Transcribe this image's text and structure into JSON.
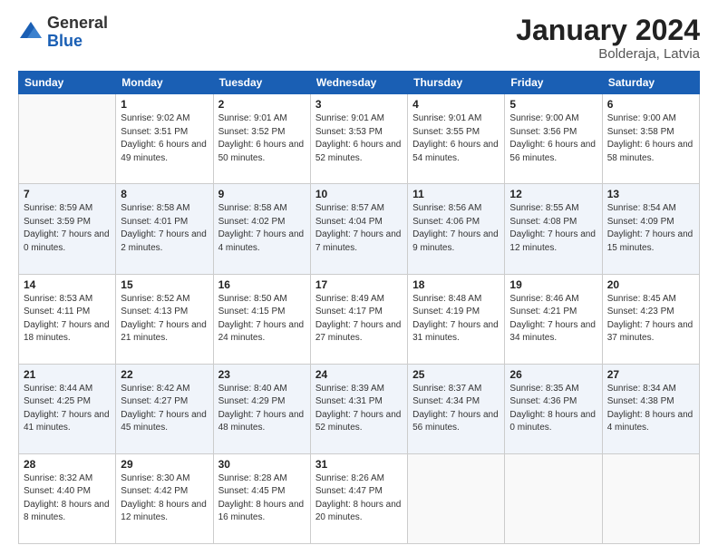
{
  "header": {
    "logo_general": "General",
    "logo_blue": "Blue",
    "month_title": "January 2024",
    "location": "Bolderaja, Latvia"
  },
  "days_of_week": [
    "Sunday",
    "Monday",
    "Tuesday",
    "Wednesday",
    "Thursday",
    "Friday",
    "Saturday"
  ],
  "weeks": [
    [
      {
        "day": "",
        "empty": true
      },
      {
        "day": "1",
        "sunrise": "Sunrise: 9:02 AM",
        "sunset": "Sunset: 3:51 PM",
        "daylight": "Daylight: 6 hours and 49 minutes."
      },
      {
        "day": "2",
        "sunrise": "Sunrise: 9:01 AM",
        "sunset": "Sunset: 3:52 PM",
        "daylight": "Daylight: 6 hours and 50 minutes."
      },
      {
        "day": "3",
        "sunrise": "Sunrise: 9:01 AM",
        "sunset": "Sunset: 3:53 PM",
        "daylight": "Daylight: 6 hours and 52 minutes."
      },
      {
        "day": "4",
        "sunrise": "Sunrise: 9:01 AM",
        "sunset": "Sunset: 3:55 PM",
        "daylight": "Daylight: 6 hours and 54 minutes."
      },
      {
        "day": "5",
        "sunrise": "Sunrise: 9:00 AM",
        "sunset": "Sunset: 3:56 PM",
        "daylight": "Daylight: 6 hours and 56 minutes."
      },
      {
        "day": "6",
        "sunrise": "Sunrise: 9:00 AM",
        "sunset": "Sunset: 3:58 PM",
        "daylight": "Daylight: 6 hours and 58 minutes."
      }
    ],
    [
      {
        "day": "7",
        "sunrise": "Sunrise: 8:59 AM",
        "sunset": "Sunset: 3:59 PM",
        "daylight": "Daylight: 7 hours and 0 minutes."
      },
      {
        "day": "8",
        "sunrise": "Sunrise: 8:58 AM",
        "sunset": "Sunset: 4:01 PM",
        "daylight": "Daylight: 7 hours and 2 minutes."
      },
      {
        "day": "9",
        "sunrise": "Sunrise: 8:58 AM",
        "sunset": "Sunset: 4:02 PM",
        "daylight": "Daylight: 7 hours and 4 minutes."
      },
      {
        "day": "10",
        "sunrise": "Sunrise: 8:57 AM",
        "sunset": "Sunset: 4:04 PM",
        "daylight": "Daylight: 7 hours and 7 minutes."
      },
      {
        "day": "11",
        "sunrise": "Sunrise: 8:56 AM",
        "sunset": "Sunset: 4:06 PM",
        "daylight": "Daylight: 7 hours and 9 minutes."
      },
      {
        "day": "12",
        "sunrise": "Sunrise: 8:55 AM",
        "sunset": "Sunset: 4:08 PM",
        "daylight": "Daylight: 7 hours and 12 minutes."
      },
      {
        "day": "13",
        "sunrise": "Sunrise: 8:54 AM",
        "sunset": "Sunset: 4:09 PM",
        "daylight": "Daylight: 7 hours and 15 minutes."
      }
    ],
    [
      {
        "day": "14",
        "sunrise": "Sunrise: 8:53 AM",
        "sunset": "Sunset: 4:11 PM",
        "daylight": "Daylight: 7 hours and 18 minutes."
      },
      {
        "day": "15",
        "sunrise": "Sunrise: 8:52 AM",
        "sunset": "Sunset: 4:13 PM",
        "daylight": "Daylight: 7 hours and 21 minutes."
      },
      {
        "day": "16",
        "sunrise": "Sunrise: 8:50 AM",
        "sunset": "Sunset: 4:15 PM",
        "daylight": "Daylight: 7 hours and 24 minutes."
      },
      {
        "day": "17",
        "sunrise": "Sunrise: 8:49 AM",
        "sunset": "Sunset: 4:17 PM",
        "daylight": "Daylight: 7 hours and 27 minutes."
      },
      {
        "day": "18",
        "sunrise": "Sunrise: 8:48 AM",
        "sunset": "Sunset: 4:19 PM",
        "daylight": "Daylight: 7 hours and 31 minutes."
      },
      {
        "day": "19",
        "sunrise": "Sunrise: 8:46 AM",
        "sunset": "Sunset: 4:21 PM",
        "daylight": "Daylight: 7 hours and 34 minutes."
      },
      {
        "day": "20",
        "sunrise": "Sunrise: 8:45 AM",
        "sunset": "Sunset: 4:23 PM",
        "daylight": "Daylight: 7 hours and 37 minutes."
      }
    ],
    [
      {
        "day": "21",
        "sunrise": "Sunrise: 8:44 AM",
        "sunset": "Sunset: 4:25 PM",
        "daylight": "Daylight: 7 hours and 41 minutes."
      },
      {
        "day": "22",
        "sunrise": "Sunrise: 8:42 AM",
        "sunset": "Sunset: 4:27 PM",
        "daylight": "Daylight: 7 hours and 45 minutes."
      },
      {
        "day": "23",
        "sunrise": "Sunrise: 8:40 AM",
        "sunset": "Sunset: 4:29 PM",
        "daylight": "Daylight: 7 hours and 48 minutes."
      },
      {
        "day": "24",
        "sunrise": "Sunrise: 8:39 AM",
        "sunset": "Sunset: 4:31 PM",
        "daylight": "Daylight: 7 hours and 52 minutes."
      },
      {
        "day": "25",
        "sunrise": "Sunrise: 8:37 AM",
        "sunset": "Sunset: 4:34 PM",
        "daylight": "Daylight: 7 hours and 56 minutes."
      },
      {
        "day": "26",
        "sunrise": "Sunrise: 8:35 AM",
        "sunset": "Sunset: 4:36 PM",
        "daylight": "Daylight: 8 hours and 0 minutes."
      },
      {
        "day": "27",
        "sunrise": "Sunrise: 8:34 AM",
        "sunset": "Sunset: 4:38 PM",
        "daylight": "Daylight: 8 hours and 4 minutes."
      }
    ],
    [
      {
        "day": "28",
        "sunrise": "Sunrise: 8:32 AM",
        "sunset": "Sunset: 4:40 PM",
        "daylight": "Daylight: 8 hours and 8 minutes."
      },
      {
        "day": "29",
        "sunrise": "Sunrise: 8:30 AM",
        "sunset": "Sunset: 4:42 PM",
        "daylight": "Daylight: 8 hours and 12 minutes."
      },
      {
        "day": "30",
        "sunrise": "Sunrise: 8:28 AM",
        "sunset": "Sunset: 4:45 PM",
        "daylight": "Daylight: 8 hours and 16 minutes."
      },
      {
        "day": "31",
        "sunrise": "Sunrise: 8:26 AM",
        "sunset": "Sunset: 4:47 PM",
        "daylight": "Daylight: 8 hours and 20 minutes."
      },
      {
        "day": "",
        "empty": true
      },
      {
        "day": "",
        "empty": true
      },
      {
        "day": "",
        "empty": true
      }
    ]
  ]
}
